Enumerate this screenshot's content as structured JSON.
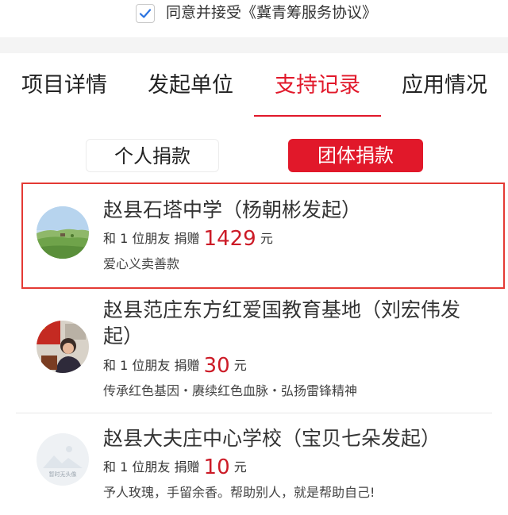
{
  "agreement": {
    "text": "同意并接受《冀青筹服务协议》",
    "checked": true
  },
  "tabs": [
    {
      "label": "项目详情",
      "active": false
    },
    {
      "label": "发起单位",
      "active": false
    },
    {
      "label": "支持记录",
      "active": true
    },
    {
      "label": "应用情况",
      "active": false
    }
  ],
  "segments": {
    "personal": "个人捐款",
    "group": "团体捐款",
    "selected": "group"
  },
  "colors": {
    "accent": "#e1182a",
    "highlight_border": "#e43a34",
    "amount": "#cc1b27"
  },
  "records": [
    {
      "name": "赵县石塔中学（杨朝彬发起）",
      "prefix": "和 1 位朋友 捐赠",
      "amount": "1429",
      "unit": "元",
      "message": "爱心义卖善款",
      "avatar": "landscape-avatar"
    },
    {
      "name": "赵县范庄东方红爱国教育基地（刘宏伟发起）",
      "prefix": "和 1 位朋友 捐赠",
      "amount": "30",
      "unit": "元",
      "message": "传承红色基因・赓续红色血脉・弘扬雷锋精神",
      "avatar": "person-avatar"
    },
    {
      "name": "赵县大夫庄中心学校（宝贝七朵发起）",
      "prefix": "和 1 位朋友 捐赠",
      "amount": "10",
      "unit": "元",
      "message": "予人玫瑰，手留余香。帮助别人，就是帮助自己!",
      "avatar": "placeholder-avatar",
      "avatar_text": "暂时无头像"
    }
  ]
}
